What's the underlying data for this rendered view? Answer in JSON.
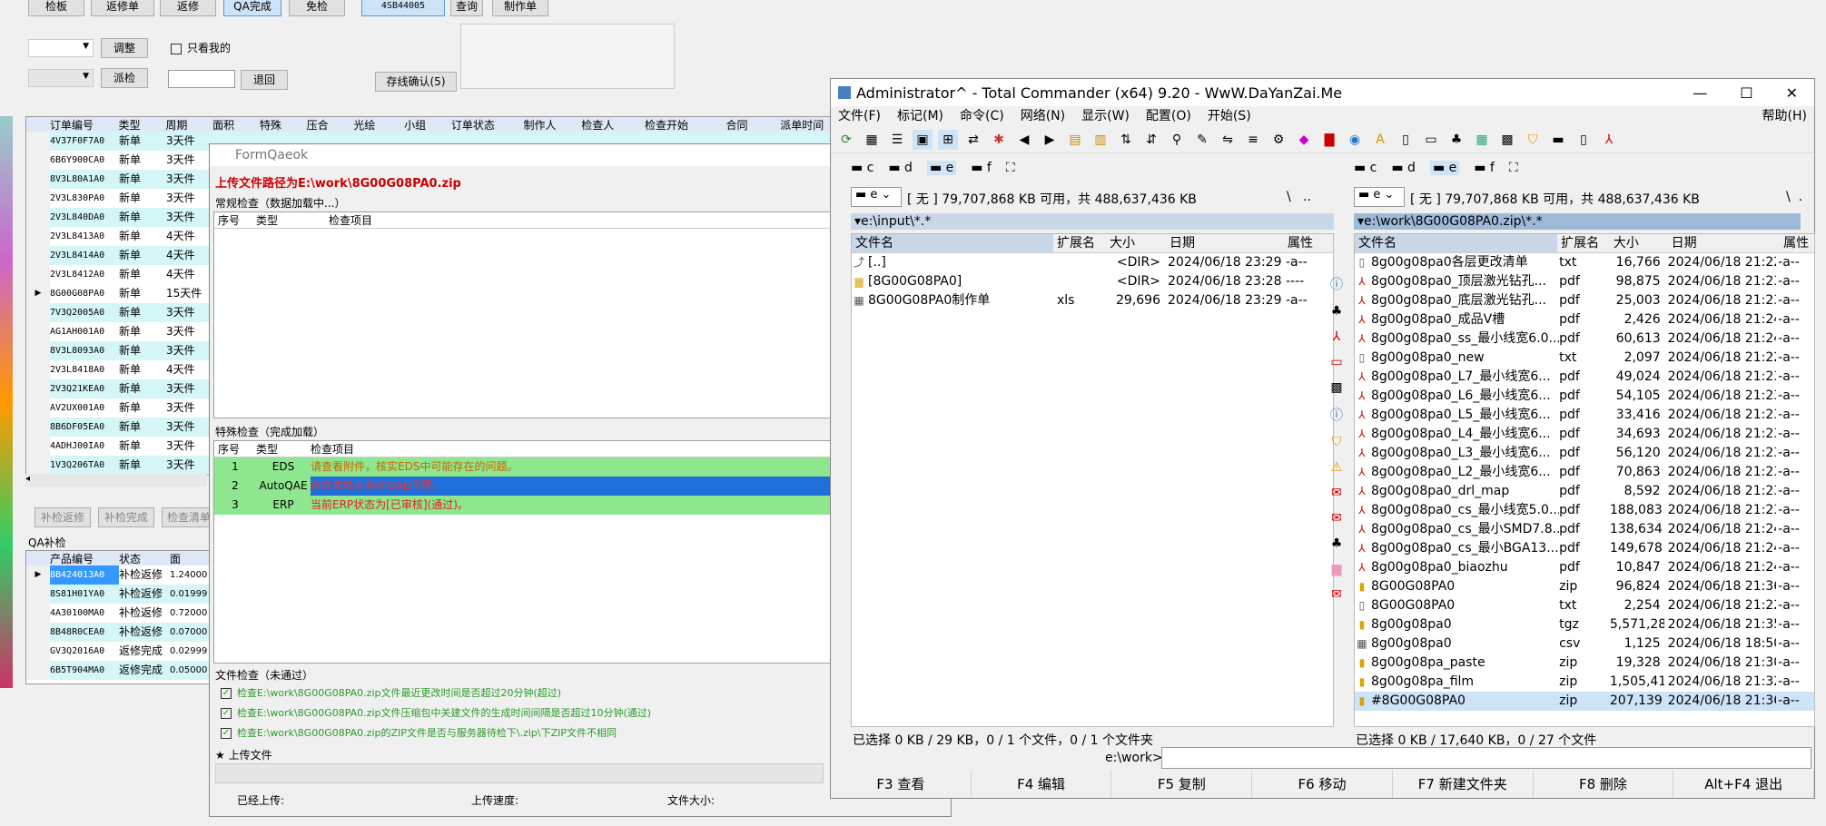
{
  "toolbar": {
    "buttons": [
      "检板",
      "返修单",
      "返修",
      "QA完成",
      "免检",
      "4SB44005",
      "查询",
      "制作单"
    ],
    "adjust": "调整",
    "only_mine": "只看我的",
    "dispatch": "派检",
    "return": "退回",
    "stock_confirm": "存线确认(5)"
  },
  "orders": {
    "headers": [
      "订单编号",
      "类型",
      "周期",
      "面积",
      "特殊",
      "压合",
      "光绘",
      "小组",
      "订单状态",
      "制作人",
      "检查人",
      "检查开始",
      "合同",
      "派单时间"
    ],
    "rows": [
      [
        "4V37F0F7A0",
        "新单",
        "3天件",
        "",
        "cyan"
      ],
      [
        "6B6Y900CA0",
        "新单",
        "3天件",
        "",
        "white"
      ],
      [
        "8V3L80A1A0",
        "新单",
        "3天件",
        "",
        "cyan"
      ],
      [
        "2V3L830PA0",
        "新单",
        "3天件",
        "",
        "white"
      ],
      [
        "2V3L840DA0",
        "新单",
        "3天件",
        "",
        "cyan"
      ],
      [
        "2V3L8413A0",
        "新单",
        "4天件",
        "",
        "white"
      ],
      [
        "2V3L8414A0",
        "新单",
        "4天件",
        "",
        "cyan"
      ],
      [
        "2V3L8412A0",
        "新单",
        "4天件",
        "",
        "white"
      ],
      [
        "8G00G08PA0",
        "新单",
        "15天件",
        "▶",
        "white"
      ],
      [
        "7V3Q2005A0",
        "新单",
        "3天件",
        "",
        "cyan"
      ],
      [
        "AG1AH001A0",
        "新单",
        "3天件",
        "",
        "white"
      ],
      [
        "8V3L8093A0",
        "新单",
        "3天件",
        "",
        "cyan"
      ],
      [
        "2V3L8418A0",
        "新单",
        "4天件",
        "",
        "white"
      ],
      [
        "2V3Q21KEA0",
        "新单",
        "3天件",
        "",
        "cyan"
      ],
      [
        "AV2UX001A0",
        "新单",
        "3天件",
        "",
        "white"
      ],
      [
        "8B6DF05EA0",
        "新单",
        "3天件",
        "",
        "cyan"
      ],
      [
        "4ADHJ00IA0",
        "新单",
        "3天件",
        "",
        "white"
      ],
      [
        "1V3Q206TA0",
        "新单",
        "3天件",
        "",
        "cyan"
      ]
    ]
  },
  "qa_buttons": [
    "补检返修",
    "补检完成",
    "检查清单"
  ],
  "qa": {
    "title": "QA补检",
    "headers": [
      "产品编号",
      "状态",
      "面"
    ],
    "rows": [
      [
        "8B424013A0",
        "补检返修",
        "1.24000"
      ],
      [
        "8S81H01YA0",
        "补检返修",
        "0.01999"
      ],
      [
        "4A30100MA0",
        "补检返修",
        "0.72000"
      ],
      [
        "8B48R0CEA0",
        "补检返修",
        "0.07000"
      ],
      [
        "GV3Q2016A0",
        "返修完成",
        "0.02999"
      ],
      [
        "6B5T904MA0",
        "返修完成",
        "0.05000"
      ]
    ]
  },
  "form": {
    "title": "FormQaeok",
    "path": "上传文件路径为E:\\work\\8G00G08PA0.zip",
    "regular": "常规检查（数据加载中...）",
    "cols": [
      "序号",
      "类型",
      "检查项目"
    ],
    "special": "特殊检查（完成加载）",
    "special_rows": [
      {
        "n": "1",
        "t": "EDS",
        "text": "请查看附件，核实EDS中可能存在的问题。"
      },
      {
        "n": "2",
        "t": "AutoQAE",
        "text": "存在未核实自动QAE问题。"
      },
      {
        "n": "3",
        "t": "ERP",
        "text": "当前ERP状态为[已审核](通过)。"
      }
    ],
    "file_check": "文件检查（未通过）",
    "checks": [
      "检查E:\\work\\8G00G08PA0.zip文件最近更改时间是否超过20分钟(超过)",
      "检查E:\\work\\8G00G08PA0.zip文件压缩包中关建文件的生成时间间隔是否超过10分钟(通过)",
      "检查E:\\work\\8G00G08PA0.zip的ZIP文件是否与服务器待检下\\.zip\\下ZIP文件不相同"
    ],
    "upload": "★ 上传文件",
    "uploaded": "已经上传:",
    "speed": "上传速度:",
    "size": "文件大小:"
  },
  "tc": {
    "title": "Administrator^ - Total Commander (x64) 9.20 - WwW.DaYanZai.Me",
    "menu": [
      "文件(F)",
      "标记(M)",
      "命令(C)",
      "网络(N)",
      "显示(W)",
      "配置(O)",
      "开始(S)"
    ],
    "help": "帮助(H)",
    "drives": [
      "c",
      "d",
      "e",
      "f"
    ],
    "left": {
      "drive": "e",
      "info": "[ 无 ]  79,707,868 KB 可用，共 488,637,436 KB",
      "path": "e:\\input\\*.*",
      "headers": [
        "文件名",
        "扩展名",
        "大小",
        "日期",
        "属性"
      ],
      "files": [
        [
          "[..]",
          "",
          "<DIR>",
          "2024/06/18 23:29",
          "-a--"
        ],
        [
          "[8G00G08PA0]",
          "",
          "<DIR>",
          "2024/06/18 23:28",
          "----"
        ],
        [
          "8G00G08PA0制作单",
          "xls",
          "29,696",
          "2024/06/18 23:29",
          "-a--"
        ]
      ],
      "status": "已选择 0 KB / 29 KB，0 / 1 个文件，0 / 1 个文件夹"
    },
    "right": {
      "drive": "e",
      "info": "[ 无 ]  79,707,868 KB 可用，共 488,637,436 KB",
      "path": "e:\\work\\8G00G08PA0.zip\\*.*",
      "headers": [
        "文件名",
        "扩展名",
        "大小",
        "日期",
        "属性"
      ],
      "files": [
        [
          "8g00g08pa0各层更改清单",
          "txt",
          "16,766",
          "2024/06/18 21:22",
          "-a--"
        ],
        [
          "8g00g08pa0_顶层激光钻孔...",
          "pdf",
          "98,875",
          "2024/06/18 21:23",
          "-a--"
        ],
        [
          "8g00g08pa0_底层激光钻孔...",
          "pdf",
          "25,003",
          "2024/06/18 21:23",
          "-a--"
        ],
        [
          "8g00g08pa0_成品V槽",
          "pdf",
          "2,426",
          "2024/06/18 21:24",
          "-a--"
        ],
        [
          "8g00g08pa0_ss_最小线宽6.0...",
          "pdf",
          "60,613",
          "2024/06/18 21:24",
          "-a--"
        ],
        [
          "8g00g08pa0_new",
          "txt",
          "2,097",
          "2024/06/18 21:22",
          "-a--"
        ],
        [
          "8g00g08pa0_L7_最小线宽6...",
          "pdf",
          "49,024",
          "2024/06/18 21:23",
          "-a--"
        ],
        [
          "8g00g08pa0_L6_最小线宽6...",
          "pdf",
          "54,105",
          "2024/06/18 21:23",
          "-a--"
        ],
        [
          "8g00g08pa0_L5_最小线宽6...",
          "pdf",
          "33,416",
          "2024/06/18 21:23",
          "-a--"
        ],
        [
          "8g00g08pa0_L4_最小线宽6...",
          "pdf",
          "34,693",
          "2024/06/18 21:23",
          "-a--"
        ],
        [
          "8g00g08pa0_L3_最小线宽6...",
          "pdf",
          "56,120",
          "2024/06/18 21:23",
          "-a--"
        ],
        [
          "8g00g08pa0_L2_最小线宽6...",
          "pdf",
          "70,863",
          "2024/06/18 21:23",
          "-a--"
        ],
        [
          "8g00g08pa0_drl_map",
          "pdf",
          "8,592",
          "2024/06/18 21:23",
          "-a--"
        ],
        [
          "8g00g08pa0_cs_最小线宽5.0...",
          "pdf",
          "188,083",
          "2024/06/18 21:23",
          "-a--"
        ],
        [
          "8g00g08pa0_cs_最小SMD7.8...",
          "pdf",
          "138,634",
          "2024/06/18 21:24",
          "-a--"
        ],
        [
          "8g00g08pa0_cs_最小BGA13...",
          "pdf",
          "149,678",
          "2024/06/18 21:24",
          "-a--"
        ],
        [
          "8g00g08pa0_biaozhu",
          "pdf",
          "10,847",
          "2024/06/18 21:24",
          "-a--"
        ],
        [
          "8G00G08PA0",
          "zip",
          "96,824",
          "2024/06/18 21:36",
          "-a--"
        ],
        [
          "8G00G08PA0",
          "txt",
          "2,254",
          "2024/06/18 21:22",
          "-a--"
        ],
        [
          "8g00g08pa0",
          "tgz",
          "5,571,285",
          "2024/06/18 21:35",
          "-a--"
        ],
        [
          "8g00g08pa0",
          "csv",
          "1,125",
          "2024/06/18 18:50",
          "-a--"
        ],
        [
          "8g00g08pa_paste",
          "zip",
          "19,328",
          "2024/06/18 21:30",
          "-a--"
        ],
        [
          "8g00g08pa_film",
          "zip",
          "1,505,416",
          "2024/06/18 21:32",
          "-a--"
        ],
        [
          "#8G00G08PA0",
          "zip",
          "207,139",
          "2024/06/18 21:36",
          "-a--"
        ]
      ],
      "status": "已选择 0 KB / 17,640 KB，0 / 27 个文件"
    },
    "cmd_label": "e:\\work>",
    "fkeys": [
      "F3 查看",
      "F4 编辑",
      "F5 复制",
      "F6 移动",
      "F7 新建文件夹",
      "F8 删除",
      "Alt+F4 退出"
    ]
  }
}
